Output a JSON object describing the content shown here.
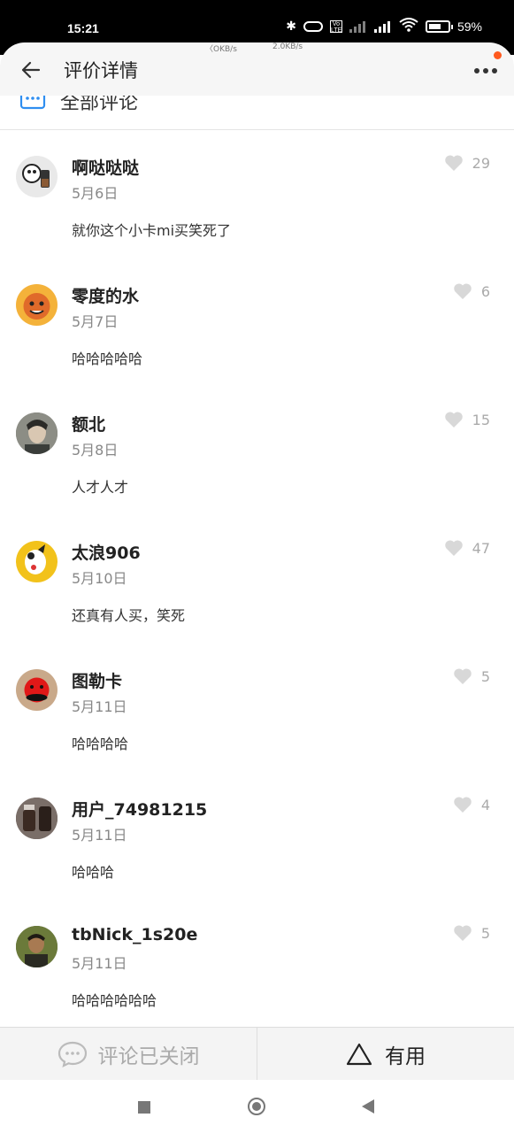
{
  "status_bar": {
    "time": "15:21",
    "battery": "59%",
    "speed_left": "〈OKB/s",
    "speed_right": "2.0KB/s"
  },
  "header": {
    "title": "评价详情"
  },
  "section": {
    "title": "全部评论"
  },
  "comments": [
    {
      "user": "啊哒哒哒",
      "date": "5月6日",
      "text": "就你这个小卡mi买笑死了",
      "likes": "29",
      "avatar_color": "#e9e9e9"
    },
    {
      "user": "零度的水",
      "date": "5月7日",
      "text": "哈哈哈哈哈",
      "likes": "6",
      "avatar_color": "#f4b23a"
    },
    {
      "user": "额北",
      "date": "5月8日",
      "text": "人才人才",
      "likes": "15",
      "avatar_color": "#6d6f68"
    },
    {
      "user": "太浪906",
      "date": "5月10日",
      "text": "还真有人买，笑死",
      "likes": "47",
      "avatar_color": "#f2c21b"
    },
    {
      "user": "图勒卡",
      "date": "5月11日",
      "text": "哈哈哈哈",
      "likes": "5",
      "avatar_color": "#c9a98a"
    },
    {
      "user": "用户_74981215",
      "date": "5月11日",
      "text": "哈哈哈",
      "likes": "4",
      "avatar_color": "#5a4a44"
    },
    {
      "user": "tbNick_1s20e",
      "date": "5月11日",
      "text": "哈哈哈哈哈哈",
      "likes": "5",
      "avatar_color": "#4b5a2e"
    }
  ],
  "bottom_bar": {
    "closed_label": "评论已关闭",
    "useful_label": "有用"
  },
  "colors": {
    "accent": "#ff5a1f",
    "heart": "#d8d8d8"
  }
}
